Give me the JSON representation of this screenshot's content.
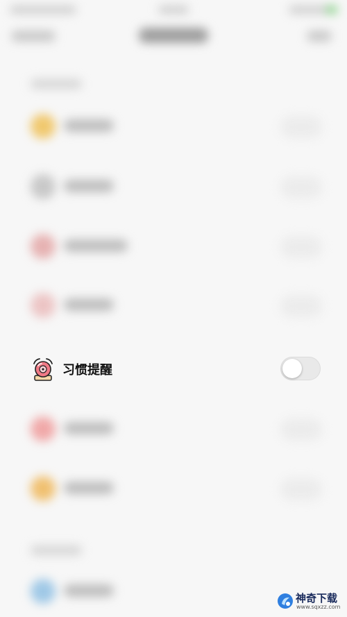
{
  "setting": {
    "label": "习惯提醒"
  },
  "watermark": {
    "name": "神奇下载",
    "url": "www.sqxzz.com"
  }
}
